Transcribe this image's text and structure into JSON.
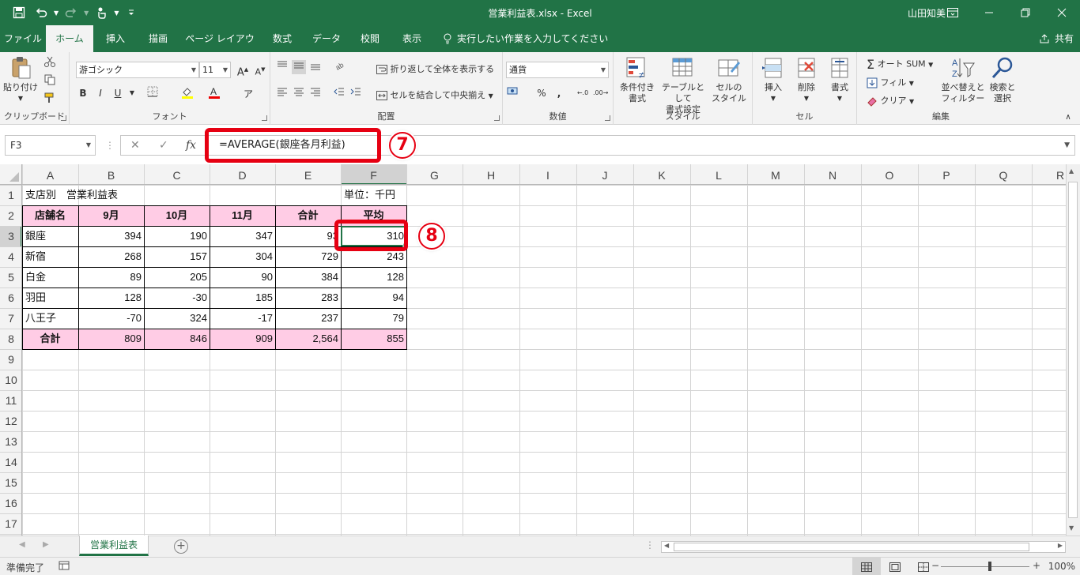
{
  "window": {
    "title": "営業利益表.xlsx  -  Excel",
    "user": "山田知美"
  },
  "tabs": [
    "ファイル",
    "ホーム",
    "挿入",
    "描画",
    "ページ レイアウト",
    "数式",
    "データ",
    "校閲",
    "表示"
  ],
  "tell_me": "実行したい作業を入力してください",
  "share": "共有",
  "ribbon": {
    "clipboard": {
      "paste": "貼り付け",
      "label": "クリップボード"
    },
    "font": {
      "name": "游ゴシック",
      "size": "11",
      "bold": "B",
      "italic": "I",
      "underline": "U",
      "grow": "A",
      "shrink": "A",
      "label": "フォント"
    },
    "alignment": {
      "wrap": "折り返して全体を表示する",
      "merge": "セルを結合して中央揃え",
      "label": "配置"
    },
    "number": {
      "format": "通貨",
      "percent": "%",
      "comma": ",",
      "label": "数値"
    },
    "styles": {
      "conditional": [
        "条件付き",
        "書式"
      ],
      "table": [
        "テーブルとして",
        "書式設定"
      ],
      "cell": [
        "セルの",
        "スタイル"
      ],
      "label": "スタイル"
    },
    "cells": {
      "insert": "挿入",
      "delete": "削除",
      "format": "書式",
      "label": "セル"
    },
    "editing": {
      "autosum": "オート SUM",
      "fill": "フィル",
      "clear": "クリア",
      "sort": [
        "並べ替えと",
        "フィルター"
      ],
      "find": [
        "検索と",
        "選択"
      ],
      "label": "編集"
    }
  },
  "formula_bar": {
    "name_box": "F3",
    "cancel": "✕",
    "enter": "✓",
    "fx": "fx",
    "formula": "=AVERAGE(銀座各月利益)"
  },
  "callouts": {
    "first": "7",
    "second": "8"
  },
  "columns": [
    "A",
    "B",
    "C",
    "D",
    "E",
    "F",
    "G",
    "H",
    "I",
    "J",
    "K",
    "L",
    "M",
    "N",
    "O",
    "P",
    "Q",
    "R"
  ],
  "rows": [
    "1",
    "2",
    "3",
    "4",
    "5",
    "6",
    "7",
    "8",
    "9",
    "10",
    "11",
    "12",
    "13",
    "14",
    "15",
    "16",
    "17"
  ],
  "sheet": {
    "title": "支店別　営業利益表",
    "unit": "単位：千円",
    "headers": [
      "店舗名",
      "9月",
      "10月",
      "11月",
      "合計",
      "平均"
    ],
    "data": [
      [
        "銀座",
        "394",
        "190",
        "347",
        "93",
        "310"
      ],
      [
        "新宿",
        "268",
        "157",
        "304",
        "729",
        "243"
      ],
      [
        "白金",
        "89",
        "205",
        "90",
        "384",
        "128"
      ],
      [
        "羽田",
        "128",
        "-30",
        "185",
        "283",
        "94"
      ],
      [
        "八王子",
        "-70",
        "324",
        "-17",
        "237",
        "79"
      ]
    ],
    "total": [
      "合計",
      "809",
      "846",
      "909",
      "2,564",
      "855"
    ]
  },
  "active_cell": "F3",
  "sheet_tab": "営業利益表",
  "status": {
    "ready": "準備完了",
    "zoom": "100%"
  },
  "colors": {
    "excel_green": "#217346",
    "header_fill": "#ffcce5",
    "callout_red": "#e60012"
  }
}
